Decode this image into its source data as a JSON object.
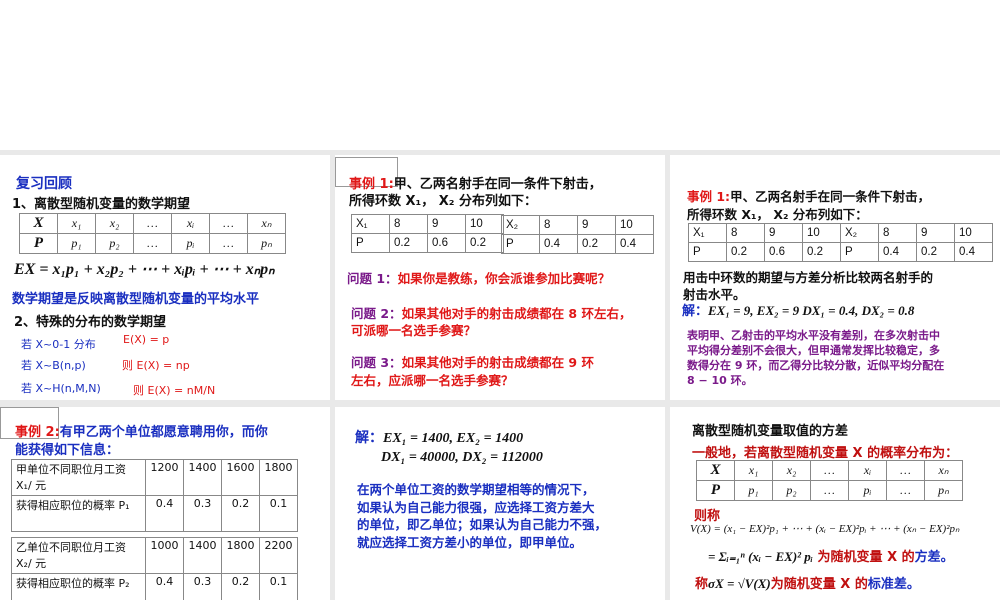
{
  "slide1": {
    "title": "复习回顾",
    "h1": "1、离散型随机变量的数学期望",
    "table": {
      "x": [
        "X",
        "x₁",
        "x₂",
        "…",
        "xᵢ",
        "…",
        "xₙ"
      ],
      "p": [
        "P",
        "p₁",
        "p₂",
        "…",
        "pᵢ",
        "…",
        "pₙ"
      ]
    },
    "formula": "EX = x₁p₁ + x₂p₂ + ⋯ + xᵢpᵢ + ⋯ + xₙpₙ",
    "note": "数学期望是反映离散型随机变量的平均水平",
    "h2": "2、特殊的分布的数学期望",
    "cases": [
      {
        "cond": "若 X~0-1 分布",
        "res": "E(X) = p"
      },
      {
        "cond": "若 X~B(n,p)",
        "res": "则 E(X) = np"
      },
      {
        "cond": "若 X~H(n,M,N)",
        "res": "则 E(X) = nM/N"
      }
    ]
  },
  "slide2": {
    "label": "事例 1:",
    "intro1": "甲、乙两名射手在同一条件下射击，",
    "intro2": "所得环数 X₁， X₂ 分布列如下：",
    "t1": [
      [
        "X₁",
        "8",
        "9",
        "10"
      ],
      [
        "P",
        "0.2",
        "0.6",
        "0.2"
      ]
    ],
    "t2": [
      [
        "X₂",
        "8",
        "9",
        "10"
      ],
      [
        "P",
        "0.4",
        "0.2",
        "0.4"
      ]
    ],
    "q1": {
      "label": "问题 1：",
      "text": "如果你是教练，你会派谁参加比赛呢？"
    },
    "q2": {
      "label": "问题 2：",
      "text": "如果其他对手的射击成绩都在 8 环左右，",
      "text2": "可派哪一名选手参赛？"
    },
    "q3": {
      "label": "问题 3：",
      "text": "如果其他对手的射击成绩都在 9 环",
      "text2": "左右，应派哪一名选手参赛？"
    }
  },
  "slide3": {
    "label": "事例 1:",
    "intro1": "甲、乙两名射手在同一条件下射击，",
    "intro2": "所得环数 X₁， X₂ 分布列如下：",
    "t1": [
      [
        "X₁",
        "8",
        "9",
        "10"
      ],
      [
        "P",
        "0.2",
        "0.6",
        "0.2"
      ]
    ],
    "t2": [
      [
        "X₂",
        "8",
        "9",
        "10"
      ],
      [
        "P",
        "0.4",
        "0.2",
        "0.4"
      ]
    ],
    "task1": "用击中环数的期望与方差分析比较两名射手的",
    "task2": "射击水平。",
    "sol_label": "解：",
    "sol": "EX₁ = 9, EX₂ = 9    DX₁ = 0.4, DX₂ = 0.8",
    "concl": [
      "表明甲、乙射击的平均水平没有差别，在多次射击中",
      "平均得分差别不会很大，但甲通常发挥比较稳定，多",
      "数得分在 9 环，而乙得分比较分散，近似平均分配在",
      "8 − 10 环。"
    ]
  },
  "slide4": {
    "label": "事例 2:",
    "intro1": "有甲乙两个单位都愿意聘用你，而你",
    "intro2": "能获得如下信息：",
    "rows": [
      {
        "label": "甲单位不同职位月工资 X₁/ 元",
        "vals": [
          "1200",
          "1400",
          "1600",
          "1800"
        ]
      },
      {
        "label": "获得相应职位的概率 P₁",
        "vals": [
          "0.4",
          "0.3",
          "0.2",
          "0.1"
        ]
      },
      {
        "label": "乙单位不同职位月工资 X₂/ 元",
        "vals": [
          "1000",
          "1400",
          "1800",
          "2200"
        ]
      },
      {
        "label": "获得相应职位的概率 P₂",
        "vals": [
          "0.4",
          "0.3",
          "0.2",
          "0.1"
        ]
      }
    ]
  },
  "slide5": {
    "sol_label": "解：",
    "line1": "EX₁ = 1400, EX₂ = 1400",
    "line2": "DX₁ = 40000, DX₂ = 112000",
    "concl": [
      "在两个单位工资的数学期望相等的情况下，",
      "如果认为自己能力很强，应选择工资方差大",
      "的单位，即乙单位；如果认为自己能力不强，",
      "就应选择工资方差小的单位，即甲单位。"
    ]
  },
  "slide6": {
    "title": "离散型随机变量取值的方差",
    "intro": "一般地，若离散型随机变量 X 的概率分布为：",
    "table": {
      "x": [
        "X",
        "x₁",
        "x₂",
        "…",
        "xᵢ",
        "…",
        "xₙ"
      ],
      "p": [
        "P",
        "p₁",
        "p₂",
        "…",
        "pᵢ",
        "…",
        "pₙ"
      ]
    },
    "then": "则称",
    "vformula": "V(X) = (x₁ − EX)²p₁ + ⋯ + (xᵢ − EX)²pᵢ + ⋯ + (xₙ − EX)²pₙ",
    "sum": "= Σᵢ₌₁ⁿ (xᵢ − EX)² pᵢ",
    "sum_text": "为随机变量 X 的",
    "variance": "方差。",
    "sd_pre": "称",
    "sd_formula": "σX = √V(X)",
    "sd_text": "为随机变量 X 的",
    "sd": "标准差。"
  }
}
